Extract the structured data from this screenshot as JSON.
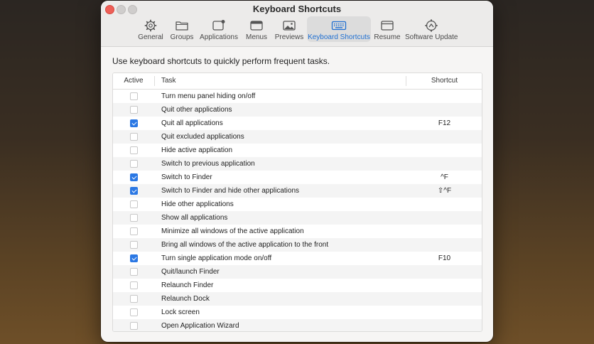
{
  "window": {
    "title": "Keyboard Shortcuts"
  },
  "toolbar": {
    "items": [
      {
        "label": "General",
        "icon": "gear-icon"
      },
      {
        "label": "Groups",
        "icon": "folder-icon"
      },
      {
        "label": "Applications",
        "icon": "app-window-icon"
      },
      {
        "label": "Menus",
        "icon": "menu-bar-icon"
      },
      {
        "label": "Previews",
        "icon": "image-icon"
      },
      {
        "label": "Keyboard Shortcuts",
        "icon": "keyboard-icon",
        "selected": true
      },
      {
        "label": "Resume",
        "icon": "window-icon"
      },
      {
        "label": "Software Update",
        "icon": "refresh-gear-icon"
      }
    ]
  },
  "intro_text": "Use keyboard shortcuts to quickly perform frequent tasks.",
  "table": {
    "headers": {
      "active": "Active",
      "task": "Task",
      "shortcut": "Shortcut"
    },
    "rows": [
      {
        "active": false,
        "task": "Turn menu panel hiding on/off",
        "shortcut": ""
      },
      {
        "active": false,
        "task": "Quit other applications",
        "shortcut": ""
      },
      {
        "active": true,
        "task": "Quit all applications",
        "shortcut": "F12"
      },
      {
        "active": false,
        "task": "Quit excluded applications",
        "shortcut": ""
      },
      {
        "active": false,
        "task": "Hide active application",
        "shortcut": ""
      },
      {
        "active": false,
        "task": "Switch to previous application",
        "shortcut": ""
      },
      {
        "active": true,
        "task": "Switch to Finder",
        "shortcut": "^F"
      },
      {
        "active": true,
        "task": "Switch to Finder and hide other applications",
        "shortcut": "⇧^F"
      },
      {
        "active": false,
        "task": "Hide other applications",
        "shortcut": ""
      },
      {
        "active": false,
        "task": "Show all applications",
        "shortcut": ""
      },
      {
        "active": false,
        "task": "Minimize all windows of the active application",
        "shortcut": ""
      },
      {
        "active": false,
        "task": "Bring all windows of the active application to the front",
        "shortcut": ""
      },
      {
        "active": true,
        "task": "Turn single application mode on/off",
        "shortcut": "F10"
      },
      {
        "active": false,
        "task": "Quit/launch Finder",
        "shortcut": ""
      },
      {
        "active": false,
        "task": "Relaunch Finder",
        "shortcut": ""
      },
      {
        "active": false,
        "task": "Relaunch Dock",
        "shortcut": ""
      },
      {
        "active": false,
        "task": "Lock screen",
        "shortcut": ""
      },
      {
        "active": false,
        "task": "Open Application Wizard",
        "shortcut": ""
      }
    ]
  },
  "colors": {
    "accent": "#2b78e4",
    "close": "#ee5f57"
  }
}
